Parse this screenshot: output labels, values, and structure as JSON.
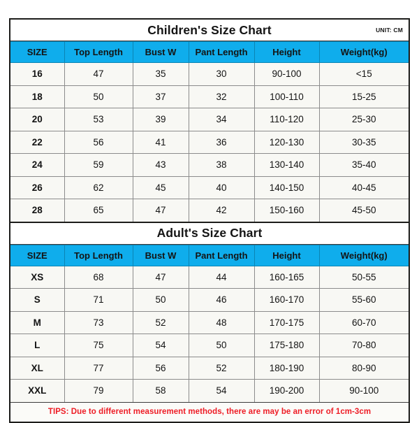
{
  "document": {
    "unit_label": "UNIT: CM",
    "tips": "TIPS: Due to different measurement methods, there are may be an error of 1cm-3cm",
    "colors": {
      "header_blue": "#0FADEC",
      "cell_background": "#F8F8F4",
      "border_gray": "#8C8C8C",
      "frame_dark": "#1D1D1B",
      "tips_red": "#EE1C25",
      "text_dark": "#141414"
    }
  },
  "children_chart": {
    "title": "Children's Size Chart",
    "columns": [
      "SIZE",
      "Top Length",
      "Bust W",
      "Pant Length",
      "Height",
      "Weight(kg)"
    ],
    "rows": [
      {
        "size": "16",
        "top_length": "47",
        "bust_w": "35",
        "pant_length": "30",
        "height": "90-100",
        "weight": "<15"
      },
      {
        "size": "18",
        "top_length": "50",
        "bust_w": "37",
        "pant_length": "32",
        "height": "100-110",
        "weight": "15-25"
      },
      {
        "size": "20",
        "top_length": "53",
        "bust_w": "39",
        "pant_length": "34",
        "height": "110-120",
        "weight": "25-30"
      },
      {
        "size": "22",
        "top_length": "56",
        "bust_w": "41",
        "pant_length": "36",
        "height": "120-130",
        "weight": "30-35"
      },
      {
        "size": "24",
        "top_length": "59",
        "bust_w": "43",
        "pant_length": "38",
        "height": "130-140",
        "weight": "35-40"
      },
      {
        "size": "26",
        "top_length": "62",
        "bust_w": "45",
        "pant_length": "40",
        "height": "140-150",
        "weight": "40-45"
      },
      {
        "size": "28",
        "top_length": "65",
        "bust_w": "47",
        "pant_length": "42",
        "height": "150-160",
        "weight": "45-50"
      }
    ]
  },
  "adult_chart": {
    "title": "Adult's Size Chart",
    "columns": [
      "SIZE",
      "Top Length",
      "Bust W",
      "Pant Length",
      "Height",
      "Weight(kg)"
    ],
    "rows": [
      {
        "size": "XS",
        "top_length": "68",
        "bust_w": "47",
        "pant_length": "44",
        "height": "160-165",
        "weight": "50-55"
      },
      {
        "size": "S",
        "top_length": "71",
        "bust_w": "50",
        "pant_length": "46",
        "height": "160-170",
        "weight": "55-60"
      },
      {
        "size": "M",
        "top_length": "73",
        "bust_w": "52",
        "pant_length": "48",
        "height": "170-175",
        "weight": "60-70"
      },
      {
        "size": "L",
        "top_length": "75",
        "bust_w": "54",
        "pant_length": "50",
        "height": "175-180",
        "weight": "70-80"
      },
      {
        "size": "XL",
        "top_length": "77",
        "bust_w": "56",
        "pant_length": "52",
        "height": "180-190",
        "weight": "80-90"
      },
      {
        "size": "XXL",
        "top_length": "79",
        "bust_w": "58",
        "pant_length": "54",
        "height": "190-200",
        "weight": "90-100"
      }
    ]
  }
}
